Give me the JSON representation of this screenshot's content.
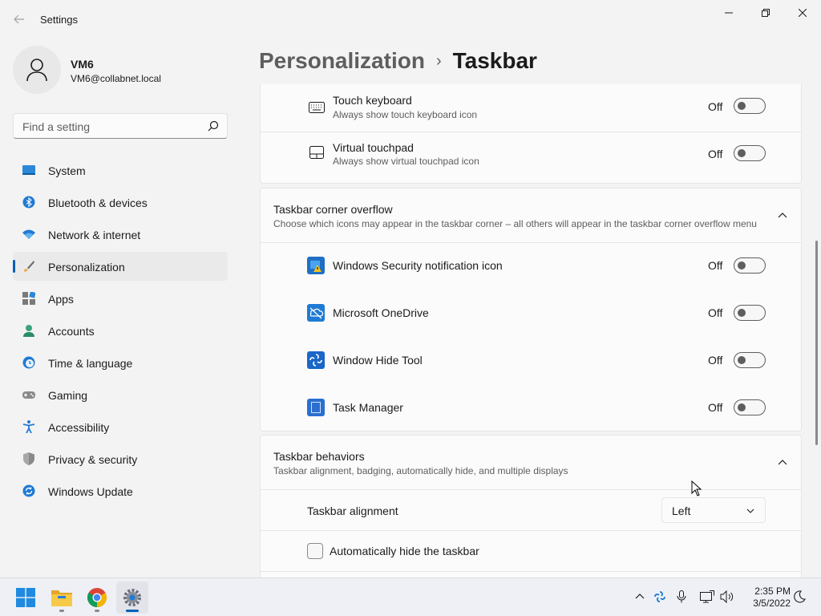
{
  "window": {
    "title": "Settings"
  },
  "user": {
    "name": "VM6",
    "email": "VM6@collabnet.local"
  },
  "search": {
    "placeholder": "Find a setting"
  },
  "sidebar": {
    "items": [
      {
        "label": "System",
        "icon": "system-icon"
      },
      {
        "label": "Bluetooth & devices",
        "icon": "bluetooth-icon"
      },
      {
        "label": "Network & internet",
        "icon": "wifi-icon"
      },
      {
        "label": "Personalization",
        "icon": "brush-icon",
        "active": true
      },
      {
        "label": "Apps",
        "icon": "apps-icon"
      },
      {
        "label": "Accounts",
        "icon": "accounts-icon"
      },
      {
        "label": "Time & language",
        "icon": "clock-globe-icon"
      },
      {
        "label": "Gaming",
        "icon": "gamepad-icon"
      },
      {
        "label": "Accessibility",
        "icon": "accessibility-icon"
      },
      {
        "label": "Privacy & security",
        "icon": "shield-icon"
      },
      {
        "label": "Windows Update",
        "icon": "update-icon"
      }
    ]
  },
  "breadcrumb": {
    "parent": "Personalization",
    "separator": "›",
    "current": "Taskbar"
  },
  "pen_menu_items": [
    {
      "title": "Touch keyboard",
      "subtitle": "Always show touch keyboard icon",
      "state": "Off",
      "icon": "keyboard-icon"
    },
    {
      "title": "Virtual touchpad",
      "subtitle": "Always show virtual touchpad icon",
      "state": "Off",
      "icon": "touchpad-icon"
    }
  ],
  "corner_overflow": {
    "title": "Taskbar corner overflow",
    "subtitle": "Choose which icons may appear in the taskbar corner – all others will appear in the taskbar corner overflow menu",
    "items": [
      {
        "title": "Windows Security notification icon",
        "state": "Off",
        "icon": "windows-security-icon"
      },
      {
        "title": "Microsoft OneDrive",
        "state": "Off",
        "icon": "onedrive-icon"
      },
      {
        "title": "Window Hide Tool",
        "state": "Off",
        "icon": "window-hide-tool-icon"
      },
      {
        "title": "Task Manager",
        "state": "Off",
        "icon": "task-manager-icon"
      }
    ]
  },
  "behaviors": {
    "title": "Taskbar behaviors",
    "subtitle": "Taskbar alignment, badging, automatically hide, and multiple displays",
    "alignment_label": "Taskbar alignment",
    "alignment_value": "Left",
    "autohide_label": "Automatically hide the taskbar"
  },
  "taskbar": {
    "apps": [
      "start-icon",
      "file-explorer-icon",
      "chrome-icon",
      "settings-icon"
    ],
    "tray": [
      "chevron-up-icon",
      "window-hide-tool-icon",
      "microphone-icon",
      "network-icon",
      "volume-icon"
    ],
    "time": "2:35 PM",
    "date": "3/5/2022"
  },
  "colors": {
    "accent": "#005fb8"
  }
}
